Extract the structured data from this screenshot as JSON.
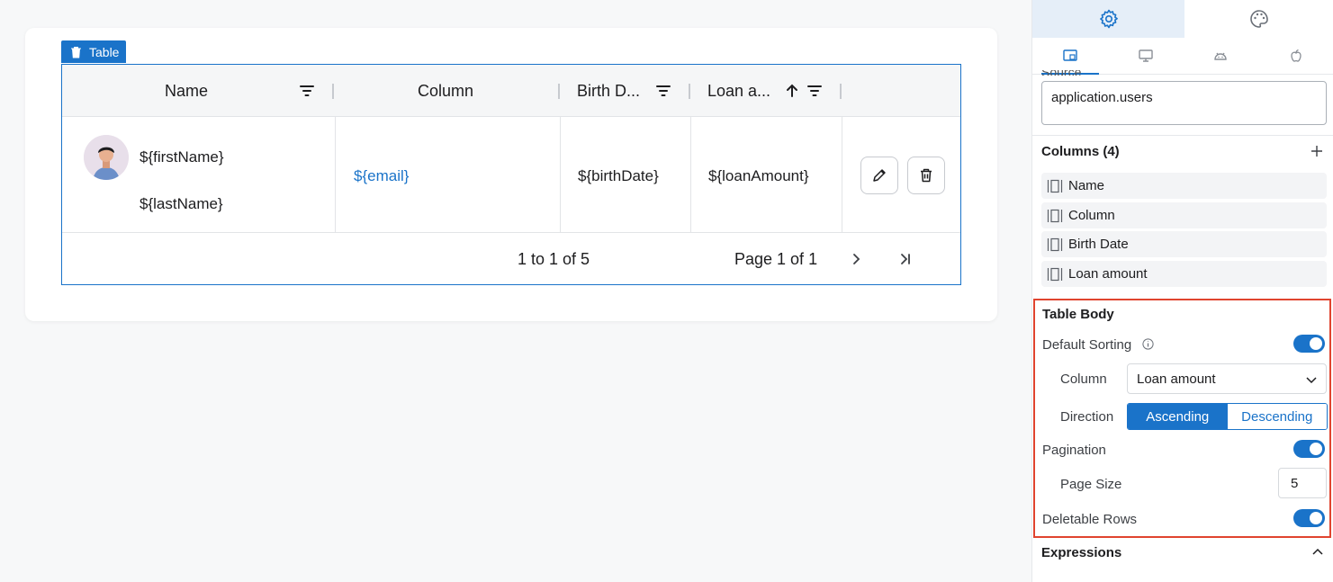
{
  "canvas": {
    "selection_tag": "Table",
    "table": {
      "headers": [
        "Name",
        "Column",
        "Birth D...",
        "Loan a..."
      ],
      "row": {
        "first_name": "${firstName}",
        "last_name": "${lastName}",
        "email": "${email}",
        "birth_date": "${birthDate}",
        "loan_amount": "${loanAmount}"
      },
      "footer": {
        "range": "1 to 1 of 5",
        "page": "Page 1 of 1"
      }
    }
  },
  "panel": {
    "source_label": "Source",
    "source_value": "application.users",
    "columns_title": "Columns (4)",
    "columns": [
      "Name",
      "Column",
      "Birth Date",
      "Loan amount"
    ],
    "table_body": {
      "title": "Table Body",
      "default_sorting_label": "Default Sorting",
      "default_sorting_on": true,
      "column_label": "Column",
      "column_value": "Loan amount",
      "direction_label": "Direction",
      "direction_options": [
        "Ascending",
        "Descending"
      ],
      "direction_selected": "Ascending",
      "pagination_label": "Pagination",
      "pagination_on": true,
      "page_size_label": "Page Size",
      "page_size_value": "5",
      "deletable_rows_label": "Deletable Rows",
      "deletable_rows_on": true
    },
    "expressions_title": "Expressions"
  },
  "colors": {
    "accent": "#1a73c9",
    "highlight": "#e0442f"
  }
}
